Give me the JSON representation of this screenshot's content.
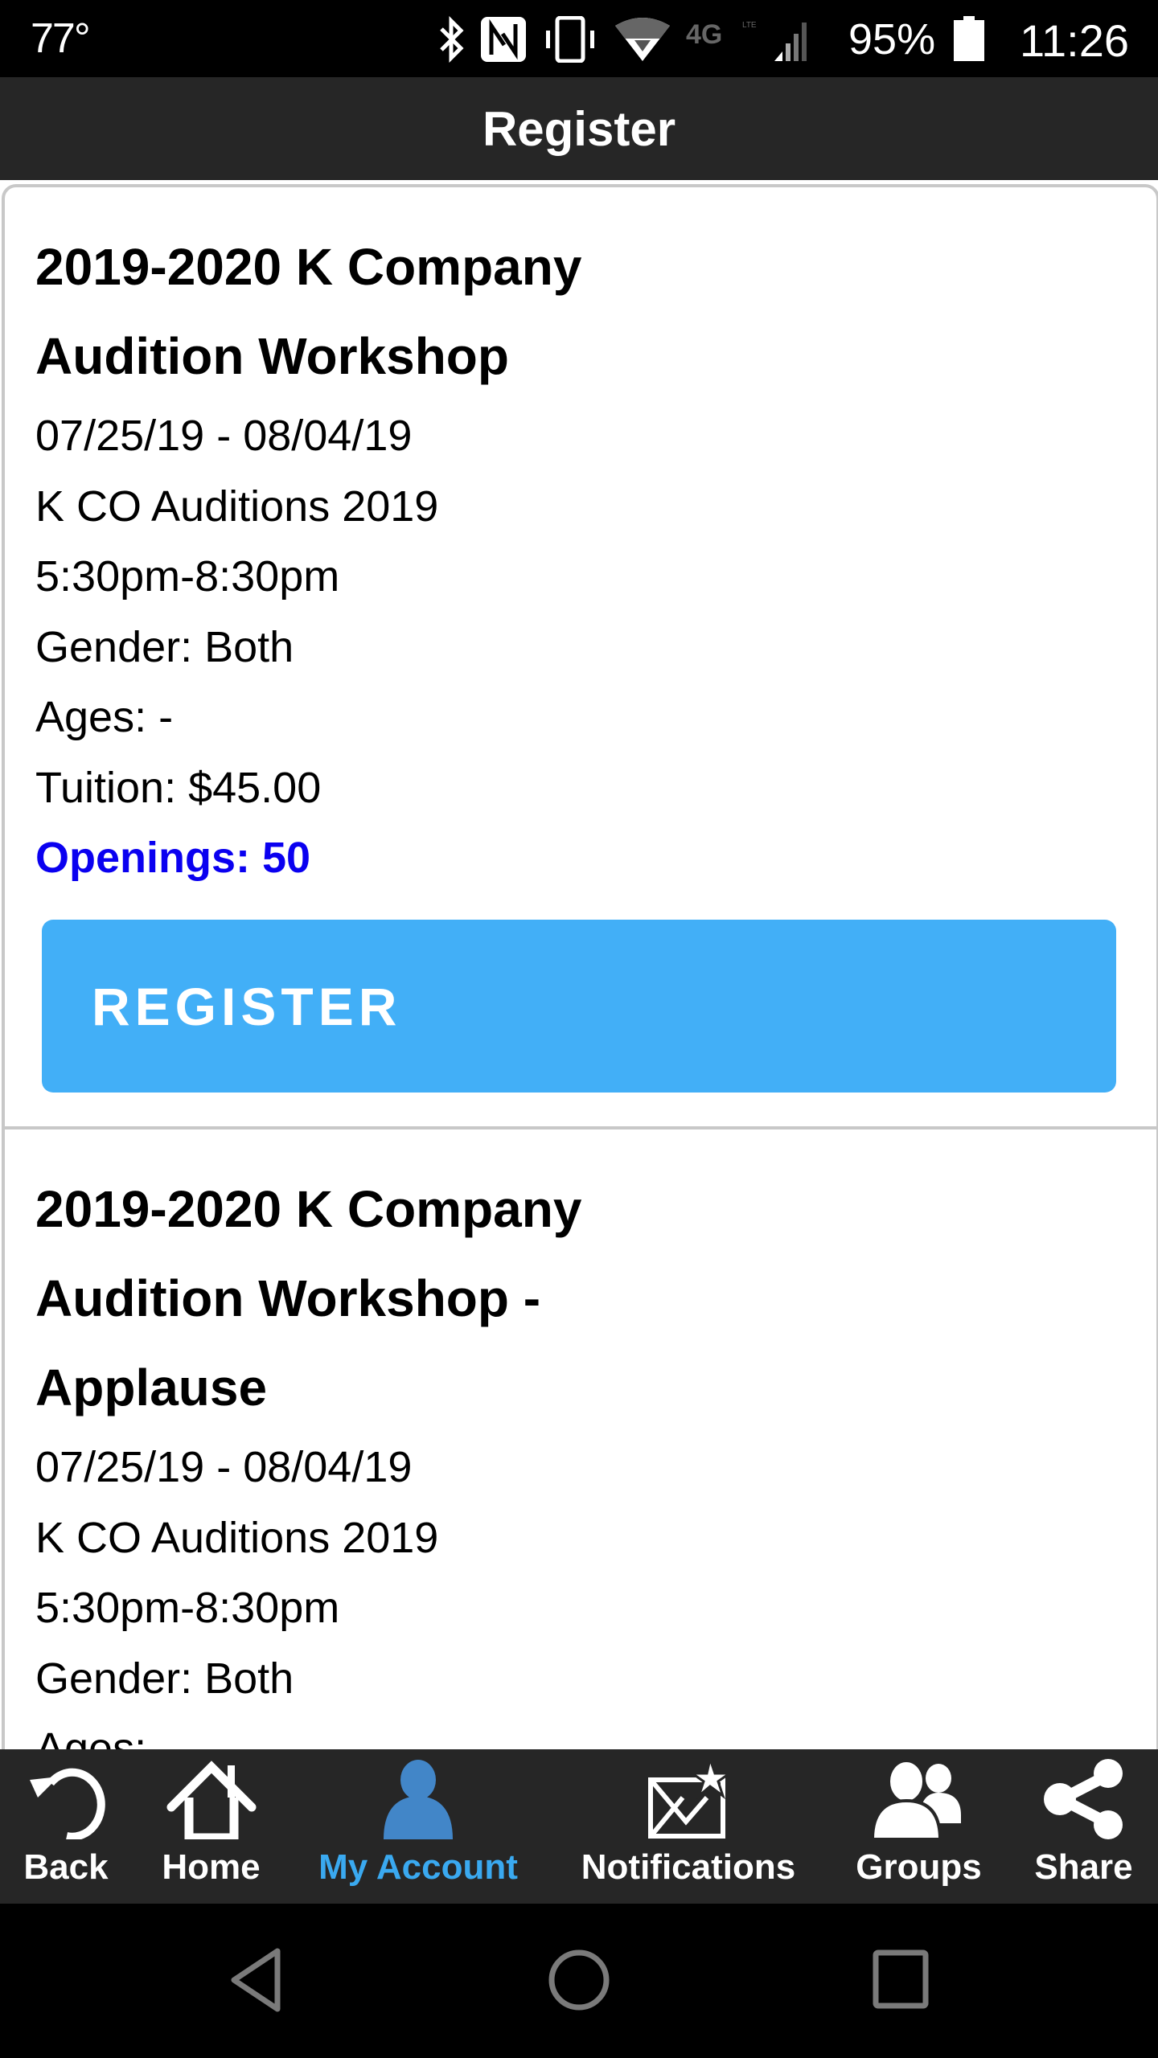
{
  "status_bar": {
    "temperature": "77°",
    "icons": [
      "bluetooth-icon",
      "nfc-icon",
      "vibrate-icon",
      "wifi-icon",
      "4g-lte-icon",
      "signal-icon"
    ],
    "network_label": "4G LTE",
    "battery_percent": "95%",
    "time": "11:26"
  },
  "header": {
    "title": "Register"
  },
  "colors": {
    "header_bg": "#262626",
    "button_bg": "#42aff7",
    "openings_text": "#0a00f0",
    "active_nav": "#3aa9f0"
  },
  "classes": [
    {
      "title_lines": [
        "2019-2020 K Company",
        "Audition Workshop"
      ],
      "dates": "07/25/19 - 08/04/19",
      "session": "K CO Auditions 2019",
      "time": "5:30pm-8:30pm",
      "gender": "Gender: Both",
      "ages": "Ages: -",
      "tuition": "Tuition: $45.00",
      "openings": "Openings: 50",
      "button_label": "REGISTER"
    },
    {
      "title_lines": [
        "2019-2020 K Company",
        "Audition Workshop -",
        "Applause"
      ],
      "dates": "07/25/19 - 08/04/19",
      "session": "K CO Auditions 2019",
      "time": "5:30pm-8:30pm",
      "gender": "Gender: Both",
      "ages": "Ages: -"
    }
  ],
  "bottom_nav": [
    {
      "label": "Back",
      "icon": "back-arrow-icon",
      "active": false
    },
    {
      "label": "Home",
      "icon": "home-icon",
      "active": false
    },
    {
      "label": "My Account",
      "icon": "person-icon",
      "active": true
    },
    {
      "label": "Notifications",
      "icon": "envelope-star-icon",
      "active": false
    },
    {
      "label": "Groups",
      "icon": "group-icon",
      "active": false
    },
    {
      "label": "Share",
      "icon": "share-icon",
      "active": false
    }
  ],
  "system_nav": [
    "back",
    "home",
    "recents"
  ]
}
